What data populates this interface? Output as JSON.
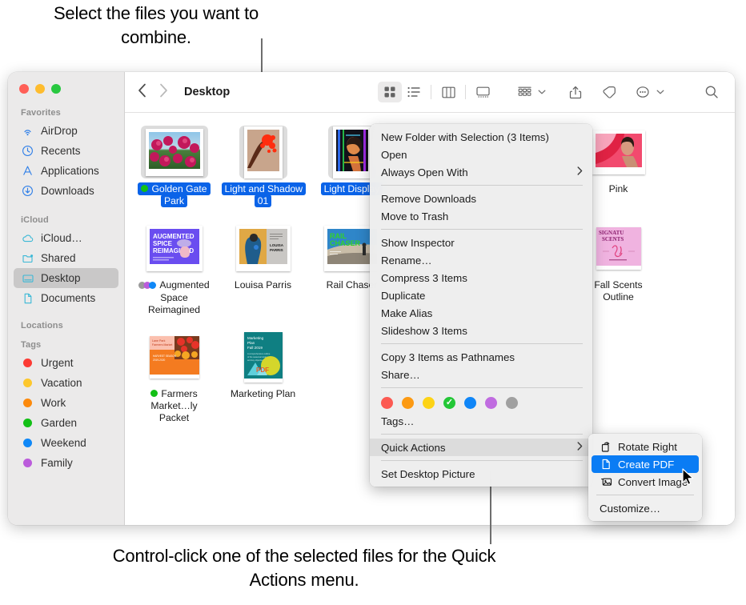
{
  "callouts": {
    "top": "Select the files you want to combine.",
    "bottom": "Control-click one of the selected files for the Quick Actions menu."
  },
  "window": {
    "title": "Desktop",
    "traffic_lights": [
      "close-red",
      "minimize-yellow",
      "zoom-green"
    ]
  },
  "toolbar": {
    "back_label": "‹",
    "forward_label": "›",
    "view_icon_grid": "icon-view",
    "view_list": "list-view",
    "view_column": "column-view",
    "view_gallery": "gallery-view",
    "group_label": "group-by",
    "share_label": "share",
    "tags_label": "tags",
    "more_label": "more-actions",
    "search_label": "search",
    "chevron": "⌄"
  },
  "sidebar": {
    "sections": [
      {
        "header": "Favorites",
        "items": [
          {
            "label": "AirDrop",
            "icon": "airdrop-icon",
            "selected": false
          },
          {
            "label": "Recents",
            "icon": "clock-icon",
            "selected": false
          },
          {
            "label": "Applications",
            "icon": "applications-icon",
            "selected": false
          },
          {
            "label": "Downloads",
            "icon": "downloads-icon",
            "selected": false
          }
        ]
      },
      {
        "header": "iCloud",
        "items": [
          {
            "label": "iCloud…",
            "icon": "cloud-icon",
            "selected": false
          },
          {
            "label": "Shared",
            "icon": "shared-folder-icon",
            "selected": false
          },
          {
            "label": "Desktop",
            "icon": "desktop-icon",
            "selected": true
          },
          {
            "label": "Documents",
            "icon": "document-icon",
            "selected": false
          }
        ]
      },
      {
        "header": "Locations",
        "items": []
      },
      {
        "header": "Tags",
        "items": [
          {
            "label": "Urgent",
            "icon": "tag-dot",
            "color": "#fc3b34",
            "selected": false
          },
          {
            "label": "Vacation",
            "icon": "tag-dot",
            "color": "#fdc72d",
            "selected": false
          },
          {
            "label": "Work",
            "icon": "tag-dot",
            "color": "#fc8a0c",
            "selected": false
          },
          {
            "label": "Garden",
            "icon": "tag-dot",
            "color": "#13c016",
            "selected": false
          },
          {
            "label": "Weekend",
            "icon": "tag-dot",
            "color": "#1088f7",
            "selected": false
          },
          {
            "label": "Family",
            "icon": "tag-dot",
            "color": "#bb5cdb",
            "selected": false
          }
        ]
      }
    ]
  },
  "files": {
    "rows": [
      [
        {
          "name": "Golden Gate Park",
          "selected": true,
          "tag_color": "#13c016",
          "kind": "photo"
        },
        {
          "name": "Light and Shadow 01",
          "selected": true,
          "tag_color": null,
          "kind": "photo"
        },
        {
          "name": "Light Display",
          "selected": true,
          "tag_color": null,
          "kind": "photo"
        },
        {
          "name": "",
          "selected": false,
          "tag_color": null,
          "kind": "hidden"
        },
        {
          "name": "",
          "selected": false,
          "tag_color": null,
          "kind": "hidden"
        },
        {
          "name": "Pink",
          "selected": false,
          "tag_color": null,
          "kind": "photo"
        }
      ],
      [
        {
          "name": "Augmented Space Reimagined",
          "selected": false,
          "tag_color": "multi",
          "kind": "photo"
        },
        {
          "name": "Louisa Parris",
          "selected": false,
          "tag_color": null,
          "kind": "photo"
        },
        {
          "name": "Rail Chaser",
          "selected": false,
          "tag_color": null,
          "kind": "photo"
        },
        {
          "name": "",
          "selected": false,
          "tag_color": null,
          "kind": "hidden"
        },
        {
          "name": "",
          "selected": false,
          "tag_color": null,
          "kind": "hidden"
        },
        {
          "name": "Fall Scents Outline",
          "selected": false,
          "tag_color": null,
          "kind": "doc"
        }
      ],
      [
        {
          "name": "Farmers Market…ly Packet",
          "selected": false,
          "tag_color": "#13c016",
          "kind": "doc"
        },
        {
          "name": "Marketing Plan",
          "selected": false,
          "tag_color": null,
          "kind": "pdf"
        }
      ]
    ]
  },
  "context_menu": {
    "groups": [
      [
        "New Folder with Selection (3 Items)",
        "Open",
        "Always Open With"
      ],
      [
        "Remove Downloads",
        "Move to Trash"
      ],
      [
        "Show Inspector",
        "Rename…",
        "Compress 3 Items",
        "Duplicate",
        "Make Alias",
        "Slideshow 3 Items"
      ],
      [
        "Copy 3 Items as Pathnames",
        "Share…"
      ]
    ],
    "submenu_arrow": "›",
    "tag_colors": [
      "#fc5a52",
      "#fc9a13",
      "#fdd316",
      "#23c736",
      "#1086f7",
      "#c06ce0",
      "#a0a0a0"
    ],
    "tag_selected_index": 3,
    "tags_label": "Tags…",
    "quick_actions_label": "Quick Actions",
    "set_desktop_picture_label": "Set Desktop Picture",
    "highlight_color": "#dcdcdc"
  },
  "quick_actions_submenu": {
    "items": [
      {
        "label": "Rotate Right",
        "icon": "rotate-right-icon",
        "selected": false
      },
      {
        "label": "Create PDF",
        "icon": "pdf-page-icon",
        "selected": true
      },
      {
        "label": "Convert Image",
        "icon": "convert-image-icon",
        "selected": false
      }
    ],
    "customize_label": "Customize…",
    "selection_color": "#0a7cf4"
  }
}
